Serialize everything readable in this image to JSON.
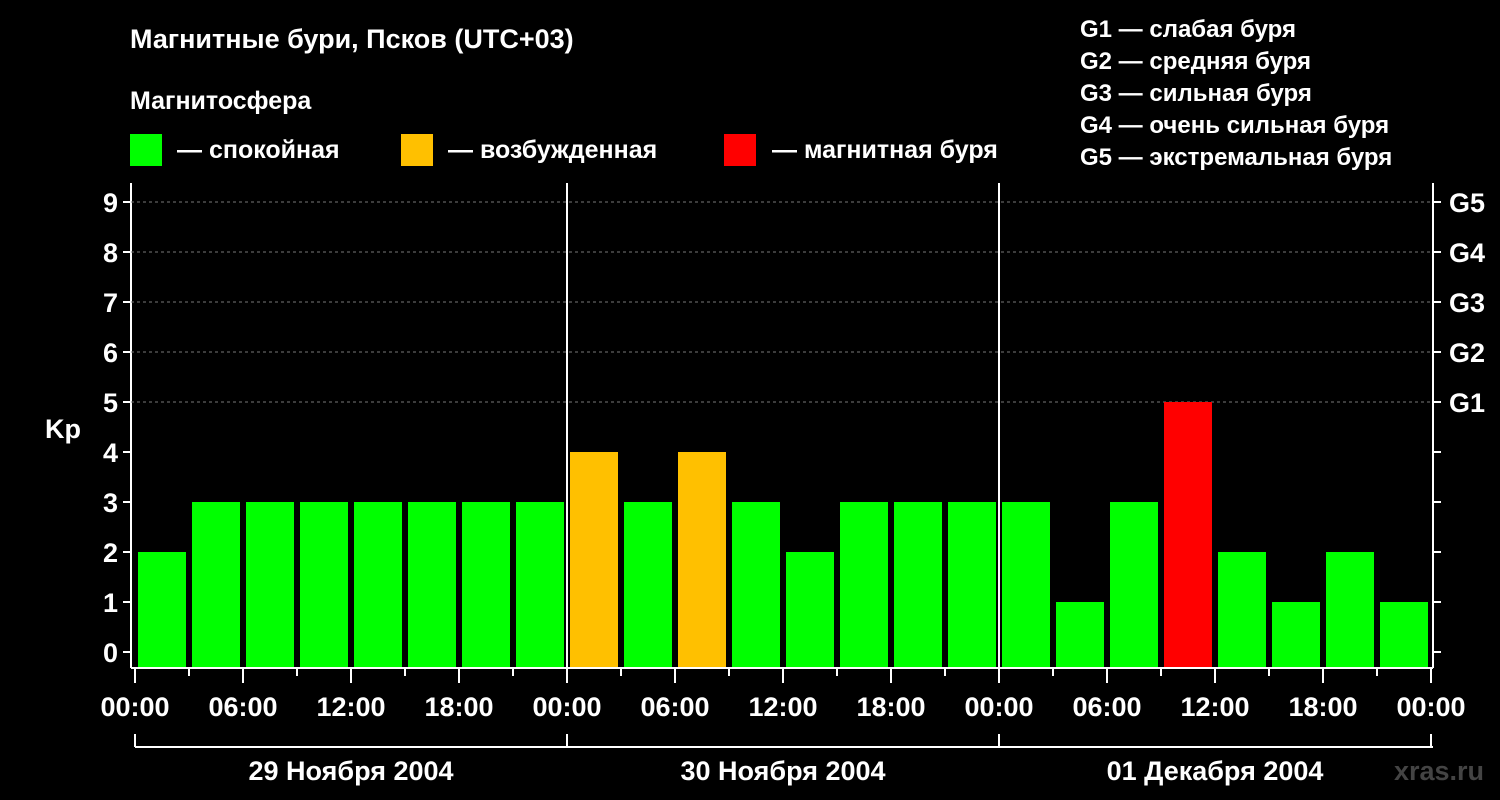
{
  "title": "Магнитные бури, Псков (UTC+03)",
  "legend": {
    "heading": "Магнитосфера",
    "items": [
      {
        "label": "— спокойная",
        "color": "#00ff00"
      },
      {
        "label": "— возбужденная",
        "color": "#ffc000"
      },
      {
        "label": "— магнитная буря",
        "color": "#ff0000"
      }
    ]
  },
  "storm_scale": [
    "G1 — слабая буря",
    "G2 — средняя буря",
    "G3 — сильная буря",
    "G4 — очень сильная буря",
    "G5 — экстремальная буря"
  ],
  "watermark": "xras.ru",
  "chart_data": {
    "type": "bar",
    "ylabel": "Kp",
    "ylim": [
      0,
      9
    ],
    "y_ticks": [
      "0",
      "1",
      "2",
      "3",
      "4",
      "5",
      "6",
      "7",
      "8",
      "9"
    ],
    "right_axis_labels": [
      {
        "kp": 5,
        "label": "G1"
      },
      {
        "kp": 6,
        "label": "G2"
      },
      {
        "kp": 7,
        "label": "G3"
      },
      {
        "kp": 8,
        "label": "G4"
      },
      {
        "kp": 9,
        "label": "G5"
      }
    ],
    "x_tick_labels": [
      "00:00",
      "06:00",
      "12:00",
      "18:00",
      "00:00",
      "06:00",
      "12:00",
      "18:00",
      "00:00",
      "06:00",
      "12:00",
      "18:00",
      "00:00"
    ],
    "days": [
      "29 Ноября 2004",
      "30 Ноября 2004",
      "01 Декабря 2004"
    ],
    "interval_hours": 3,
    "values": [
      2,
      3,
      3,
      3,
      3,
      3,
      3,
      3,
      4,
      3,
      4,
      3,
      2,
      3,
      3,
      3,
      3,
      1,
      3,
      5,
      2,
      1,
      2,
      1
    ],
    "colors": {
      "quiet": "#00ff00",
      "active": "#ffc000",
      "storm": "#ff0000"
    },
    "grid": "dashed horizontal lines at Kp 5–9"
  }
}
